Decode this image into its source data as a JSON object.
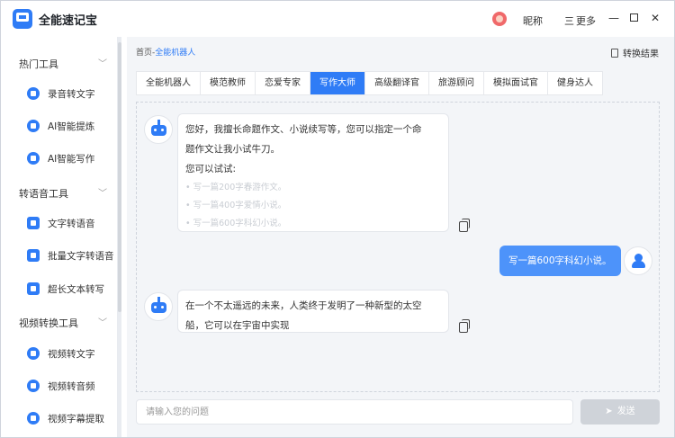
{
  "app": {
    "title": "全能速记宝",
    "user_name": "昵称",
    "more_label": "更多",
    "more_icon": "三"
  },
  "window_controls": {
    "minimize": "—",
    "close": "✕"
  },
  "sidebar": {
    "sections": [
      {
        "label": "热门工具",
        "items": [
          "录音转文字",
          "AI智能提炼",
          "AI智能写作"
        ]
      },
      {
        "label": "转语音工具",
        "items": [
          "文字转语音",
          "批量文字转语音",
          "超长文本转写"
        ]
      },
      {
        "label": "视频转换工具",
        "items": [
          "视频转文字",
          "视频转音频",
          "视频字幕提取"
        ]
      }
    ]
  },
  "breadcrumb": {
    "home": "首页",
    "sep": "-",
    "current": "全能机器人"
  },
  "convert_result_label": "转换结果",
  "tabs": [
    "全能机器人",
    "模范教师",
    "恋爱专家",
    "写作大师",
    "高级翻译官",
    "旅游顾问",
    "模拟面试官",
    "健身达人"
  ],
  "active_tab": "写作大师",
  "chat": {
    "bot_message_1": {
      "line1": "您好，我擅长命题作文、小说续写等，您可以指定一个命",
      "line2": "题作文让我小试牛刀。",
      "line3": "您可以试试:",
      "suggestions": [
        "写一篇200字春游作文。",
        "写一篇400字爱情小说。",
        "写一篇600字科幻小说。"
      ]
    },
    "user_message": "写一篇600字科幻小说。",
    "bot_message_2": {
      "line1": "在一个不太遥远的未来，人类终于发明了一种新型的太空",
      "line2": "船，它可以在宇宙中实现"
    }
  },
  "input": {
    "placeholder": "请输入您的问题",
    "value": ""
  },
  "send_label": "发送"
}
